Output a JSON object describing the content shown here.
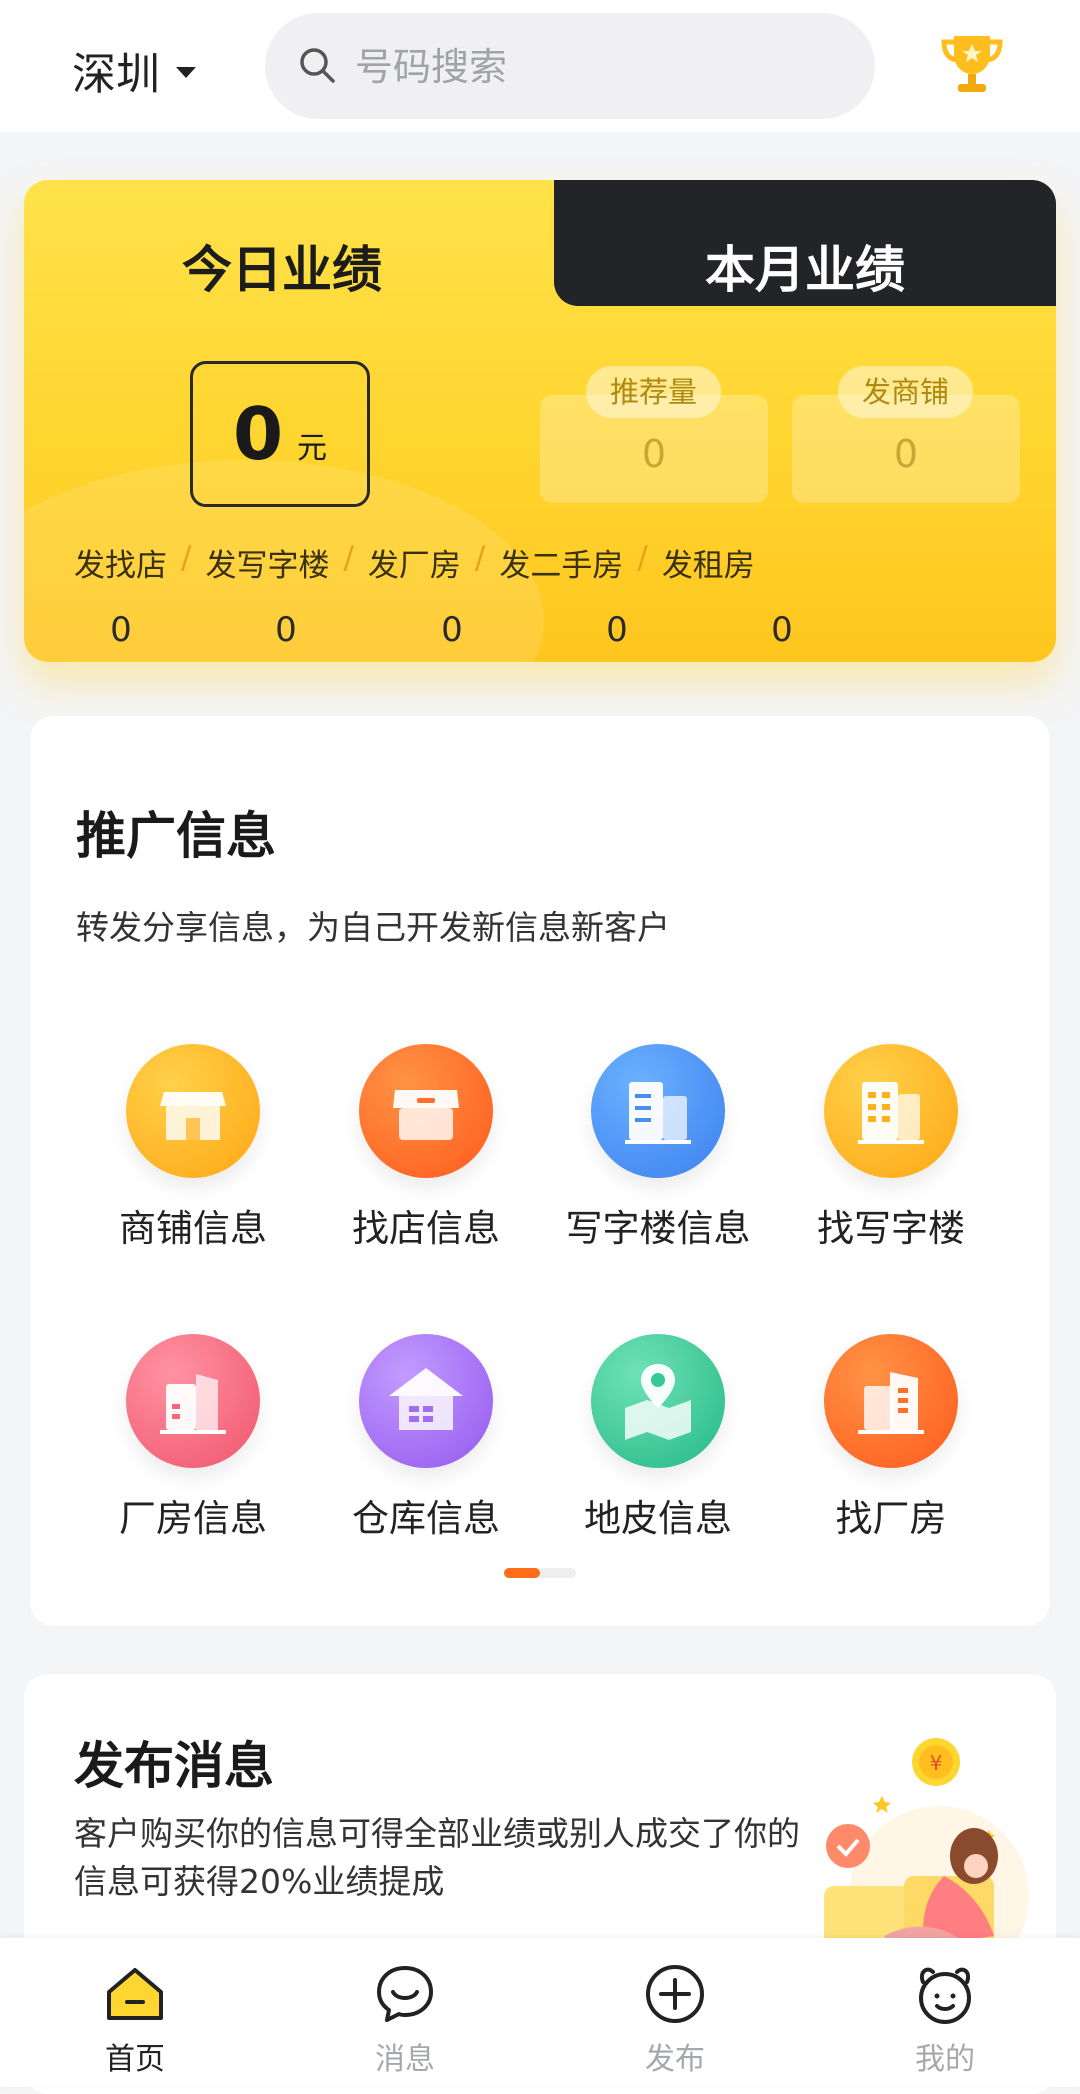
{
  "header": {
    "city": "深圳",
    "search_placeholder": "号码搜索"
  },
  "performance": {
    "tab_today": "今日业绩",
    "tab_month": "本月业绩",
    "amount": "0",
    "amount_unit": "元",
    "stats": [
      {
        "label": "推荐量",
        "value": "0"
      },
      {
        "label": "发商铺",
        "value": "0"
      }
    ],
    "categories": [
      {
        "label": "发找店",
        "value": "0"
      },
      {
        "label": "发写字楼",
        "value": "0"
      },
      {
        "label": "发厂房",
        "value": "0"
      },
      {
        "label": "发二手房",
        "value": "0"
      },
      {
        "label": "发租房",
        "value": "0"
      }
    ],
    "separator": "/"
  },
  "promo": {
    "title": "推广信息",
    "subtitle": "转发分享信息，为自己开发新信息新客户",
    "items": [
      {
        "label": "商铺信息",
        "icon": "shop-icon",
        "color": "#ffb21e"
      },
      {
        "label": "找店信息",
        "icon": "find-shop-icon",
        "color": "#ff6f2c"
      },
      {
        "label": "写字楼信息",
        "icon": "office-building-icon",
        "color": "#4a8ff0"
      },
      {
        "label": "找写字楼",
        "icon": "find-office-icon",
        "color": "#ffb21e"
      },
      {
        "label": "厂房信息",
        "icon": "factory-icon",
        "color": "#f7667a"
      },
      {
        "label": "仓库信息",
        "icon": "warehouse-icon",
        "color": "#a46df0"
      },
      {
        "label": "地皮信息",
        "icon": "land-icon",
        "color": "#34c99a"
      },
      {
        "label": "找厂房",
        "icon": "find-factory-icon",
        "color": "#ff6f2c"
      }
    ],
    "page_indicator": {
      "active": 1,
      "total": 2
    }
  },
  "publish": {
    "title": "发布消息",
    "description": "客户购买你的信息可得全部业绩或别人成交了你的信息可获得20%业绩提成"
  },
  "nav": {
    "items": [
      {
        "label": "首页",
        "icon": "home-icon",
        "active": true
      },
      {
        "label": "消息",
        "icon": "message-icon",
        "active": false
      },
      {
        "label": "发布",
        "icon": "publish-icon",
        "active": false
      },
      {
        "label": "我的",
        "icon": "profile-icon",
        "active": false
      }
    ]
  },
  "colors": {
    "accent_yellow": "#ffd52f",
    "dark_tab": "#232427",
    "indicator_orange": "#ff6d18"
  }
}
